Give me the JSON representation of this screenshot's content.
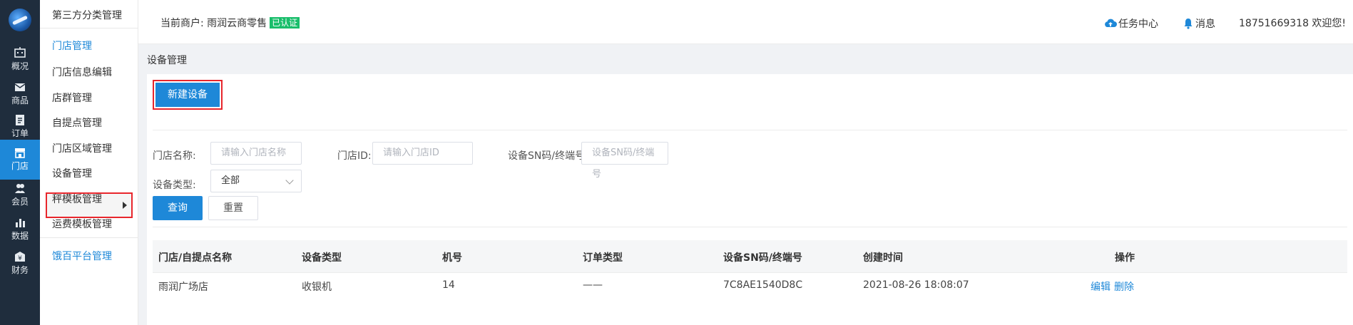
{
  "rail": {
    "items": [
      {
        "label": "概况",
        "icon": "robot-icon"
      },
      {
        "label": "商品",
        "icon": "mail-icon"
      },
      {
        "label": "订单",
        "icon": "clipboard-icon"
      },
      {
        "label": "门店",
        "icon": "store-icon"
      },
      {
        "label": "会员",
        "icon": "members-icon"
      },
      {
        "label": "数据",
        "icon": "bar-chart-icon"
      },
      {
        "label": "财务",
        "icon": "finance-icon"
      }
    ],
    "active_color": "#1e88d8"
  },
  "subnav": {
    "top_item": "第三方分类管理",
    "group_store": "门店管理",
    "items": [
      "门店信息编辑",
      "店群管理",
      "自提点管理",
      "门店区域管理",
      "设备管理",
      "秤模板管理",
      "运费模板管理"
    ],
    "group_ele": "饿百平台管理"
  },
  "header": {
    "merchant_prefix": "当前商户: 雨润云商零售",
    "verified_badge": "已认证",
    "task_center": "任务中心",
    "messages": "消息",
    "user": "18751669318 欢迎您!"
  },
  "page": {
    "breadcrumb": "设备管理",
    "new_button": "新建设备"
  },
  "filters": {
    "store_name_label": "门店名称:",
    "store_name_placeholder": "请输入门店名称",
    "store_id_label": "门店ID:",
    "store_id_placeholder": "请输入门店ID",
    "sn_label": "设备SN码/终端号:",
    "sn_placeholder": "设备SN码/终端号",
    "device_type_label": "设备类型:",
    "device_type_value": "全部",
    "query_button": "查询",
    "reset_button": "重置"
  },
  "table": {
    "headers": [
      "门店/自提点名称",
      "设备类型",
      "机号",
      "订单类型",
      "设备SN码/终端号",
      "创建时间",
      "操作"
    ],
    "rows": [
      {
        "store": "雨润广场店",
        "device_type": "收银机",
        "machine_no": "14",
        "order_type": "——",
        "sn": "7C8AE1540D8C",
        "created": "2021-08-26 18:08:07",
        "edit": "编辑",
        "delete": "删除"
      }
    ]
  },
  "colors": {
    "primary": "#1e88d8",
    "rail_bg": "#1f2d3d",
    "highlight": "#e8262c",
    "badge": "#19be6b"
  }
}
